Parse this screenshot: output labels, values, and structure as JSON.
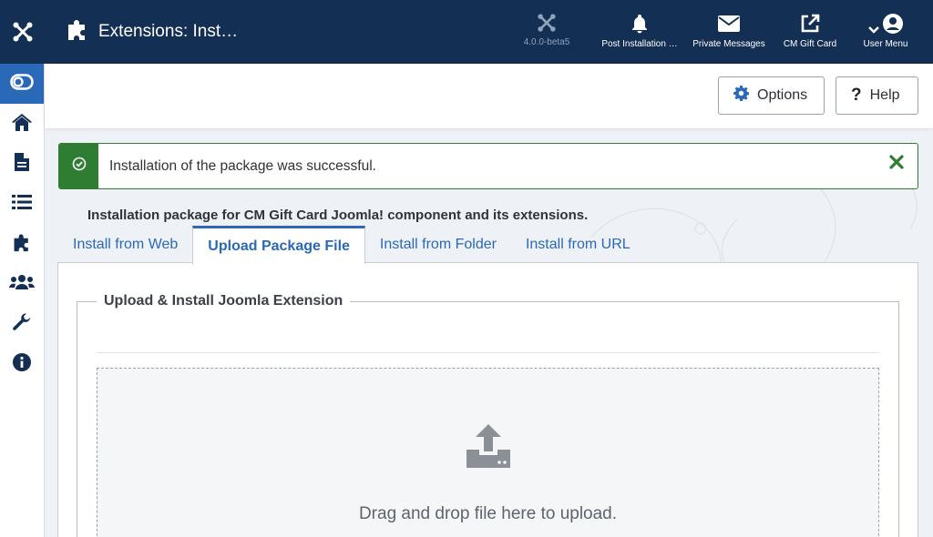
{
  "header": {
    "page_title": "Extensions: Inst…",
    "version": "4.0.0-beta5",
    "items": [
      {
        "label": "Post Installation …"
      },
      {
        "label": "Private Messages"
      },
      {
        "label": "CM Gift Card"
      },
      {
        "label": "User Menu"
      }
    ]
  },
  "toolbar": {
    "options_label": "Options",
    "help_label": "Help"
  },
  "alert": {
    "message": "Installation of the package was successful."
  },
  "package_description": "Installation package for CM Gift Card Joomla! component and its extensions.",
  "tabs": [
    {
      "label": "Install from Web"
    },
    {
      "label": "Upload Package File"
    },
    {
      "label": "Install from Folder"
    },
    {
      "label": "Install from URL"
    }
  ],
  "upload": {
    "legend": "Upload & Install Joomla Extension",
    "drop_text": "Drag and drop file here to upload."
  },
  "colors": {
    "header_bg": "#132f53",
    "accent": "#2a69b8",
    "success": "#2f7d32"
  }
}
